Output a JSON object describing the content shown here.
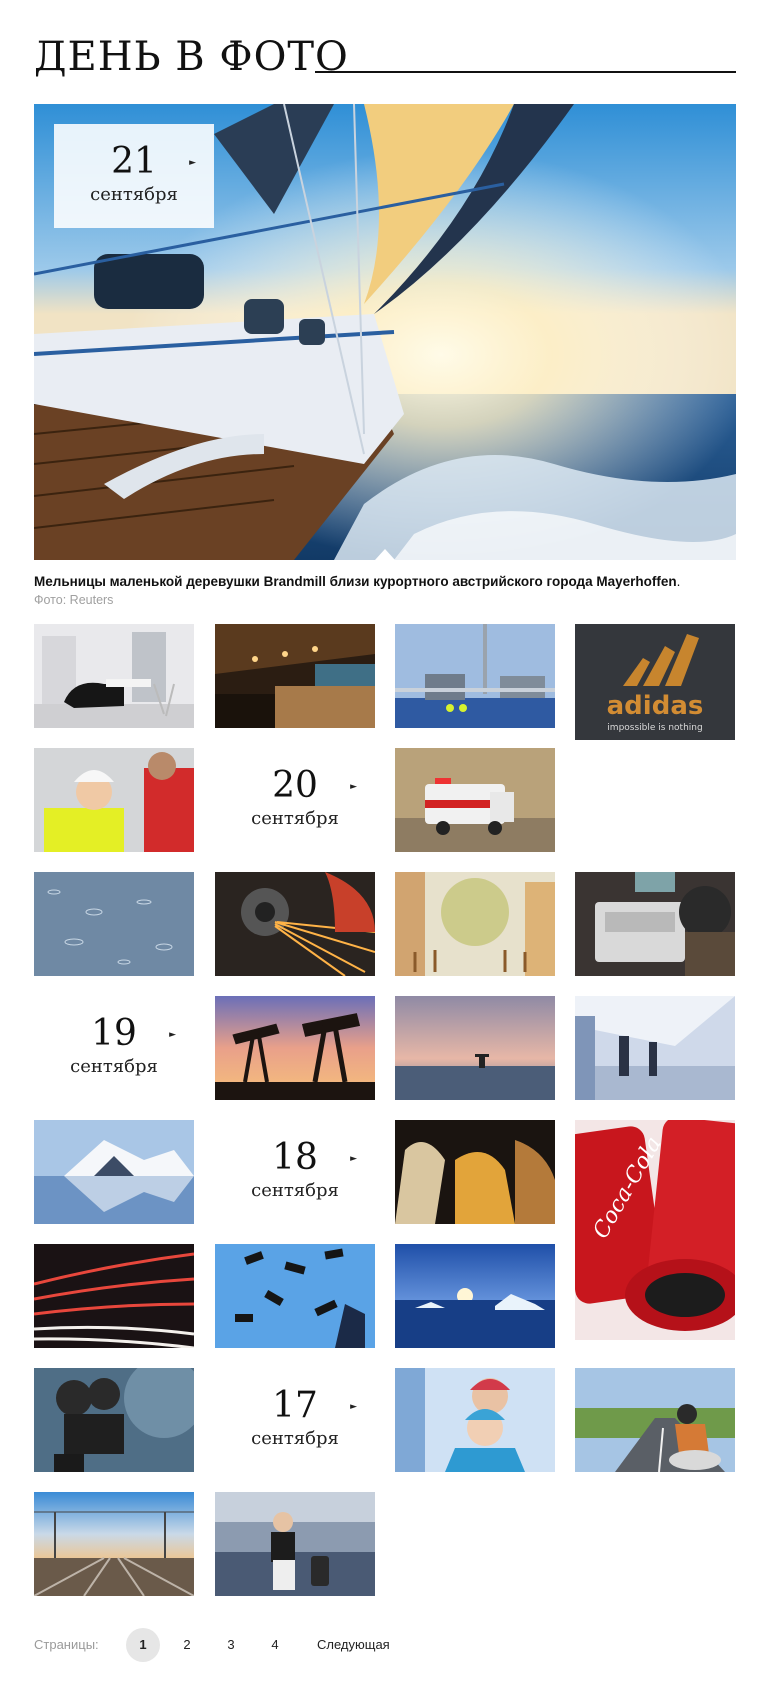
{
  "header": {
    "title": "ДЕНЬ В ФОТО"
  },
  "hero": {
    "day": "21",
    "month": "сентября",
    "caption": "Мельницы маленькой деревушки Brandmill близи курортного австрийского города Mayerhoffen",
    "caption_end": ".",
    "credit": "Фото: Reuters"
  },
  "dates": [
    {
      "day": "20",
      "month": "сентября"
    },
    {
      "day": "19",
      "month": "сентября"
    },
    {
      "day": "18",
      "month": "сентября"
    },
    {
      "day": "17",
      "month": "сентября"
    }
  ],
  "brand": {
    "logo_text": "adidas",
    "slogan": "impossible is nothing"
  },
  "coke_text": "Coca-Cola",
  "icons": {
    "date_arrow": "caret-right-icon"
  },
  "pagination": {
    "label": "Страницы:",
    "pages": [
      "1",
      "2",
      "3",
      "4"
    ],
    "active_page": "1",
    "next_label": "Следующая"
  },
  "colors": {
    "accent_dark": "#111111",
    "muted": "#a0a0a0",
    "active_page_bg": "#e6e6e6"
  }
}
